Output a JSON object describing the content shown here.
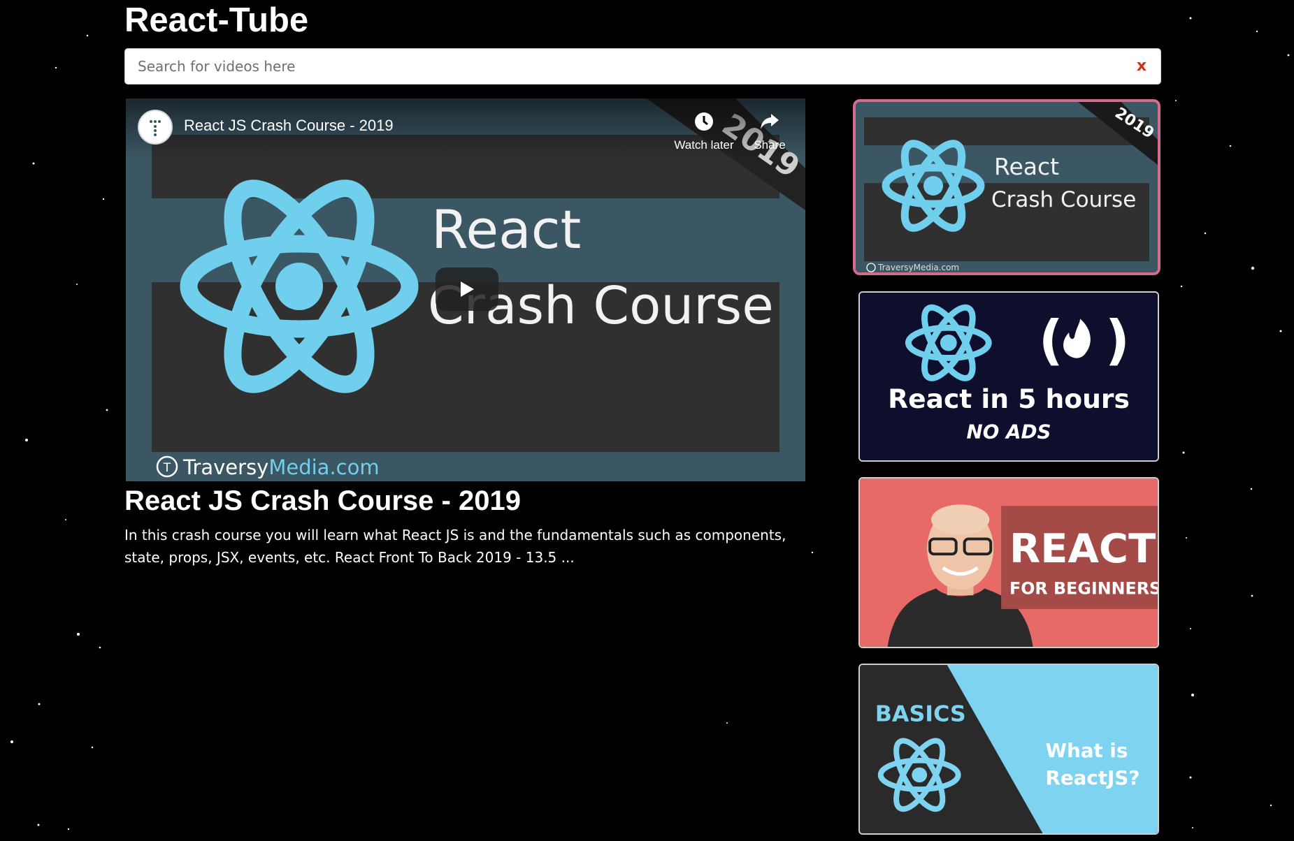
{
  "app": {
    "title": "React-Tube"
  },
  "search": {
    "placeholder": "Search for videos here",
    "value": "",
    "clear_label": "x"
  },
  "player": {
    "title": "React JS Crash Course - 2019",
    "watch_later_label": "Watch later",
    "share_label": "Share",
    "thumbnail": {
      "line1": "React",
      "line2": "Crash Course",
      "year": "2019",
      "brand_name": "Traversy",
      "brand_suffix": "Media.com"
    }
  },
  "selected_video": {
    "title": "React JS Crash Course - 2019",
    "description": "In this crash course you will learn what React JS is and the fundamentals such as components, state, props, JSX, events, etc. React Front To Back 2019 - 13.5 ..."
  },
  "video_list": [
    {
      "thumb_line1": "React",
      "thumb_line2": "Crash Course",
      "year": "2019",
      "brand": "TraversyMedia.com",
      "selected": true
    },
    {
      "thumb_line1": "React in 5 hours",
      "thumb_line2": "NO ADS",
      "selected": false
    },
    {
      "thumb_line1": "REACT",
      "thumb_line2": "FOR BEGINNERS",
      "selected": false
    },
    {
      "thumb_line1": "BASICS",
      "thumb_line2": "What is",
      "thumb_line3": "ReactJS?",
      "selected": false
    }
  ],
  "colors": {
    "background": "#000000",
    "react_blue": "#71cfee",
    "thumb_teal": "#3b5764",
    "selected_border": "#d36b8c",
    "clear_red": "#d62d1f"
  }
}
